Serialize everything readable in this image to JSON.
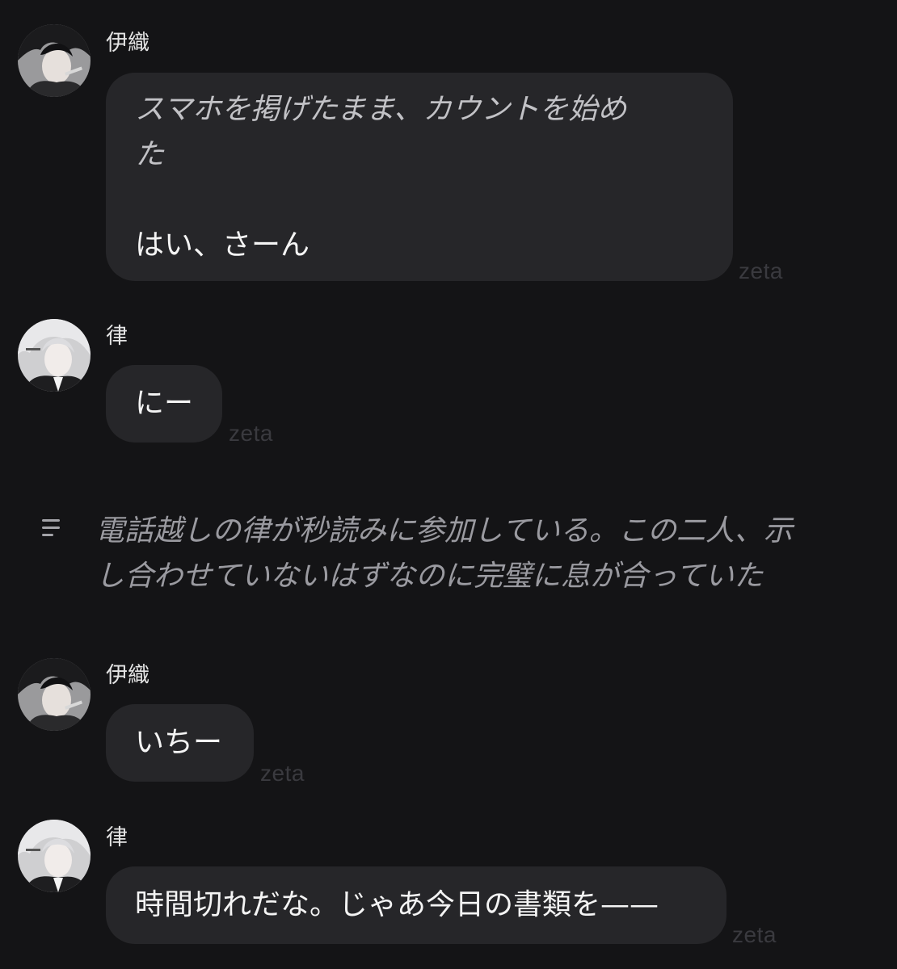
{
  "messages": [
    {
      "speaker": "伊織",
      "lines_italic": [
        "スマホを掲げたまま、カウントを始め",
        "た"
      ],
      "lines_plain": [
        "はい、さーん"
      ],
      "watermark": "zeta"
    },
    {
      "speaker": "律",
      "text": "にー",
      "watermark": "zeta"
    },
    {
      "speaker": "伊織",
      "text": "いちー",
      "watermark": "zeta"
    },
    {
      "speaker": "律",
      "text": "時間切れだな。じゃあ今日の書類を——",
      "watermark": "zeta"
    }
  ],
  "narration": {
    "icon": "menu-lines-icon",
    "lines": [
      "電話越しの律が秒読みに参加している。この二人、示",
      "し合わせていないはずなのに完璧に息が合っていた"
    ]
  },
  "colors": {
    "background": "#141416",
    "bubble": "#262629",
    "watermark": "#3a3a3f",
    "narration": "#9a9aa0"
  }
}
